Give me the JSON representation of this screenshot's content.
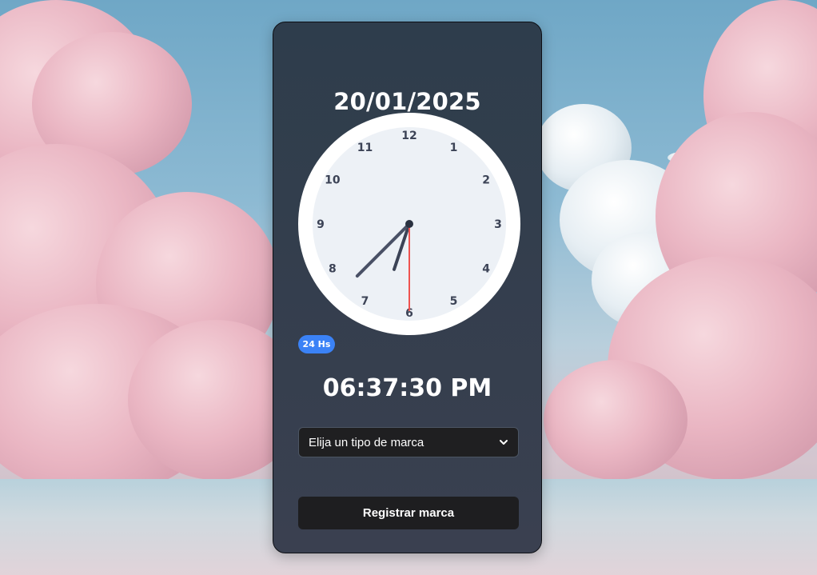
{
  "date": "20/01/2025",
  "clock": {
    "numbers": [
      "12",
      "1",
      "2",
      "3",
      "4",
      "5",
      "6",
      "7",
      "8",
      "9",
      "10",
      "11"
    ],
    "hour": 18,
    "minute": 37,
    "second": 30
  },
  "format_badge": "24 Hs",
  "time_display": "06:37:30 PM",
  "mark_type_select": {
    "selected": "Elija un tipo de marca"
  },
  "register_button": "Registrar marca",
  "colors": {
    "accent": "#3b82f6",
    "second_hand": "#ef5350",
    "hands": "#4a5166",
    "clock_face": "#edf1f6"
  }
}
